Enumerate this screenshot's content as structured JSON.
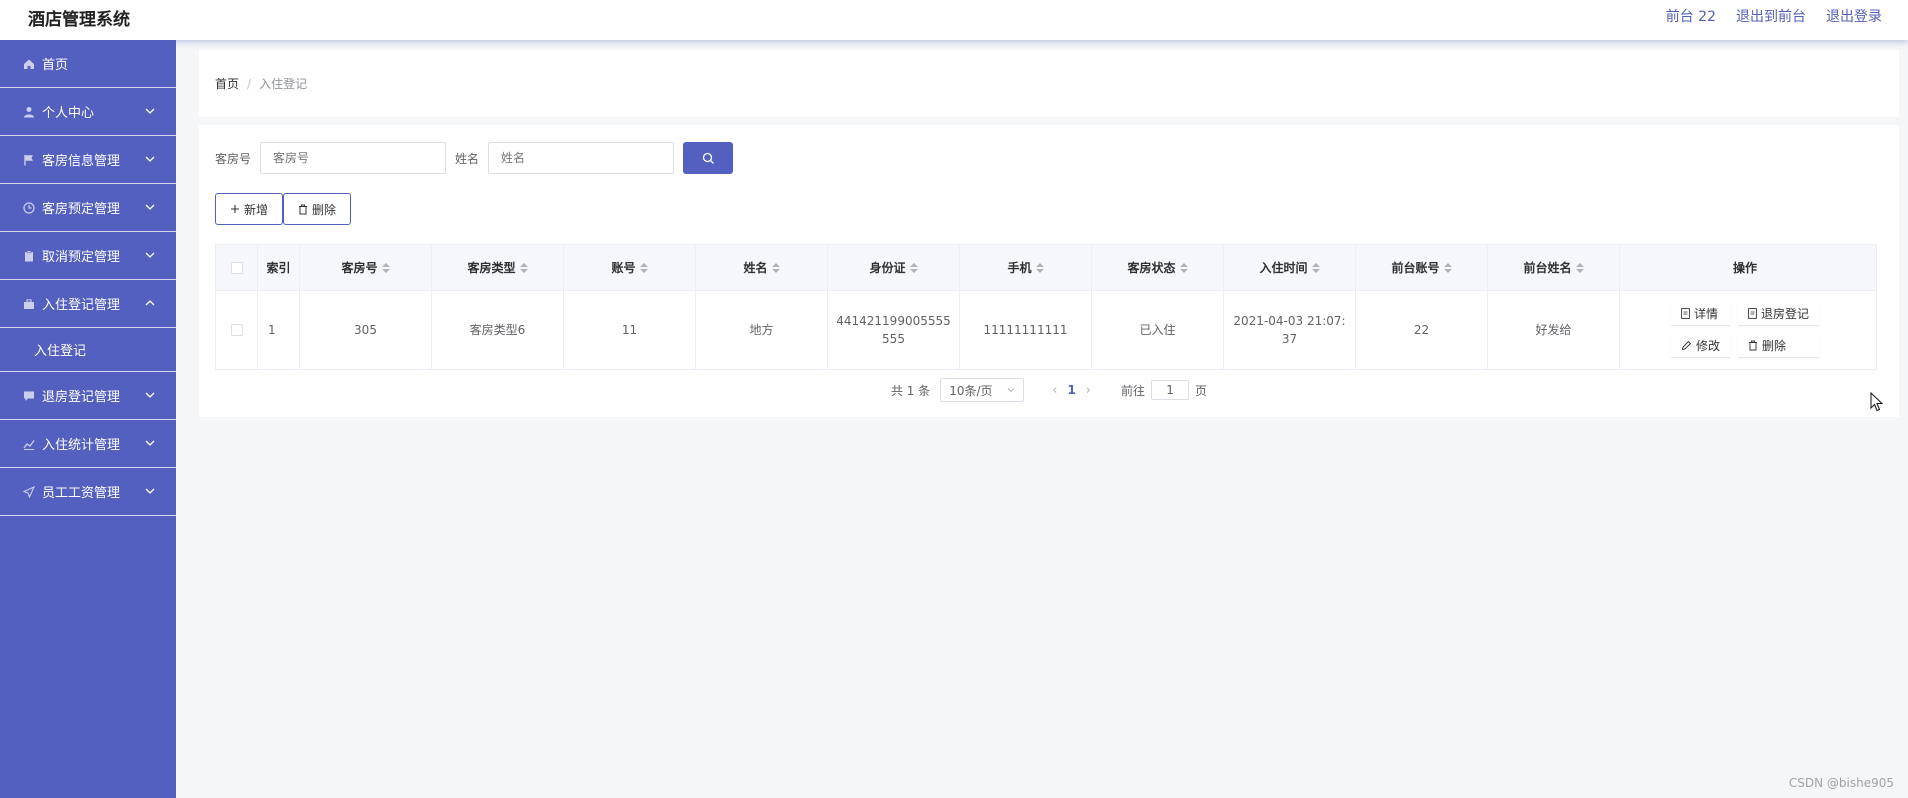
{
  "app": {
    "title": "酒店管理系统"
  },
  "header": {
    "user": "前台 22",
    "to_front": "退出到前台",
    "logout": "退出登录"
  },
  "sidebar": {
    "items": [
      {
        "label": "首页",
        "icon": "home-icon"
      },
      {
        "label": "个人中心",
        "icon": "user-icon"
      },
      {
        "label": "客房信息管理",
        "icon": "flag-icon"
      },
      {
        "label": "客房预定管理",
        "icon": "clock-icon"
      },
      {
        "label": "取消预定管理",
        "icon": "clipboard-icon"
      },
      {
        "label": "入住登记管理",
        "icon": "suitcase-icon",
        "expanded": true,
        "children": [
          {
            "label": "入住登记"
          }
        ]
      },
      {
        "label": "退房登记管理",
        "icon": "chat-icon"
      },
      {
        "label": "入住统计管理",
        "icon": "chart-icon"
      },
      {
        "label": "员工工资管理",
        "icon": "send-icon"
      }
    ]
  },
  "breadcrumb": {
    "home": "首页",
    "current": "入住登记",
    "separator": "/"
  },
  "search": {
    "room_label": "客房号",
    "room_placeholder": "客房号",
    "name_label": "姓名",
    "name_placeholder": "姓名"
  },
  "actions": {
    "add": "新增",
    "delete": "删除"
  },
  "table": {
    "columns": [
      "索引",
      "客房号",
      "客房类型",
      "账号",
      "姓名",
      "身份证",
      "手机",
      "客房状态",
      "入住时间",
      "前台账号",
      "前台姓名",
      "操作"
    ],
    "rows": [
      {
        "index": "1",
        "room": "305",
        "type": "客房类型6",
        "account": "11",
        "name": "地方",
        "id_card": "441421199005555555",
        "phone": "11111111111",
        "status": "已入住",
        "checkin": "2021-04-03 21:07:37",
        "desk_account": "22",
        "desk_name": "好发给"
      }
    ],
    "row_actions": {
      "detail": "详情",
      "checkout": "退房登记",
      "edit": "修改",
      "delete": "删除"
    }
  },
  "pagination": {
    "total": "共 1 条",
    "page_size": "10条/页",
    "current": "1",
    "goto_label": "前往",
    "goto_value": "1",
    "page_unit": "页"
  },
  "watermark": "CSDN @bishe905",
  "colors": {
    "primary": "#5460bf"
  }
}
